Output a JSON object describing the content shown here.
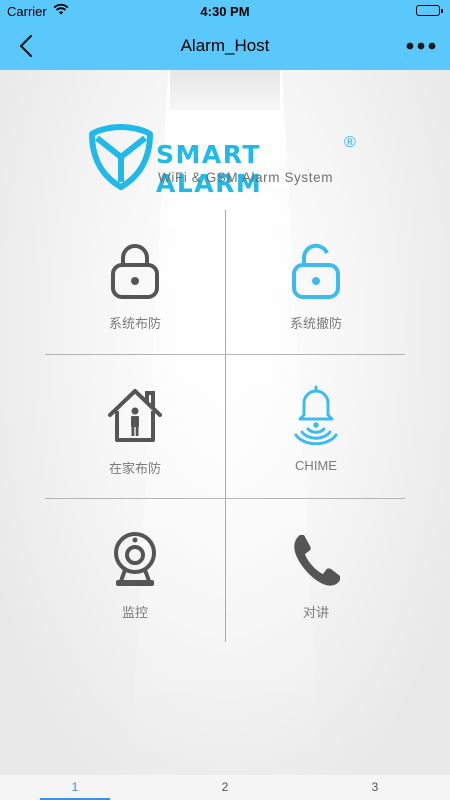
{
  "status_bar": {
    "carrier": "Carrier",
    "time": "4:30 PM",
    "battery_level": 1.0
  },
  "nav": {
    "title": "Alarm_Host",
    "back_icon": "chevron-left-icon",
    "more_icon": "more-horizontal-icon"
  },
  "logo": {
    "brand": "SMART ALARM",
    "registered": "®",
    "tagline": "WiFi & GSM Alarm System"
  },
  "grid": {
    "items": [
      {
        "label": "系统布防",
        "icon": "lock-closed-icon",
        "color": "#555555"
      },
      {
        "label": "系统撤防",
        "icon": "lock-open-icon",
        "color": "#3cbcee"
      },
      {
        "label": "在家布防",
        "icon": "home-person-icon",
        "color": "#555555"
      },
      {
        "label": "CHIME",
        "icon": "bell-wave-icon",
        "color": "#3cbcee"
      },
      {
        "label": "监控",
        "icon": "webcam-icon",
        "color": "#555555"
      },
      {
        "label": "对讲",
        "icon": "phone-icon",
        "color": "#555555"
      }
    ]
  },
  "tabs": {
    "items": [
      "1",
      "2",
      "3"
    ],
    "active_index": 0
  },
  "colors": {
    "header": "#5ac8fa",
    "brand": "#21b9ea",
    "accent": "#3a8ee6"
  }
}
